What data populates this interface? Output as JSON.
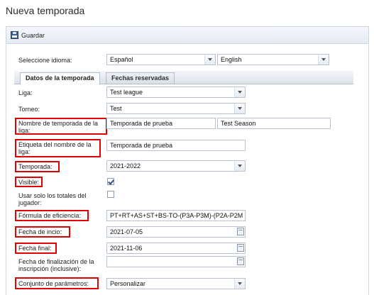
{
  "page": {
    "title": "Nueva temporada"
  },
  "toolbar": {
    "save_label": "Guardar"
  },
  "language": {
    "label": "Seleccione idioma:",
    "primary": "Español",
    "secondary": "English"
  },
  "tabs": [
    {
      "label": "Datos de la temporada",
      "active": true
    },
    {
      "label": "Fechas reservadas",
      "active": false
    }
  ],
  "form": {
    "league": {
      "label": "Liga:",
      "value": "Test league"
    },
    "tournament": {
      "label": "Torneo:",
      "value": "Test"
    },
    "season_name": {
      "label": "Nombre de temporada de la liga:",
      "value_es": "Temporada de prueba",
      "value_en": "Test Season",
      "required": true
    },
    "season_tag": {
      "label": "Etiqueta del nombre de la liga:",
      "value": "Temporada de prueba",
      "required": true
    },
    "season": {
      "label": "Temporada:",
      "value": "2021-2022",
      "required": true
    },
    "visible": {
      "label": "Visible:",
      "checked": true,
      "required": true
    },
    "player_totals": {
      "label": "Usar solo los totales del jugador:",
      "checked": false
    },
    "efficiency": {
      "label": "Fórmula de eficiencia:",
      "value": "PT+RT+AS+ST+BS-TO-(P3A-P3M)-(P2A-P2M",
      "required": true
    },
    "start_date": {
      "label": "Fecha de incio:",
      "value": "2021-07-05",
      "required": true
    },
    "end_date": {
      "label": "Fecha final:",
      "value": "2021-11-06",
      "required": true
    },
    "registration_end": {
      "label": "Fecha de finalización de la inscripción (inclusive):",
      "value": ""
    },
    "params": {
      "label": "Conjunto de parámetros:",
      "value": "Personalizar",
      "required": true
    }
  },
  "colors": {
    "required_outline": "#e00000",
    "toolbar_bg": "#e5ebf2",
    "border": "#cfd6df"
  },
  "icons": {
    "save": "floppy-disk-icon",
    "dropdown": "chevron-down-icon",
    "calendar": "calendar-icon",
    "check": "checkmark-icon"
  }
}
